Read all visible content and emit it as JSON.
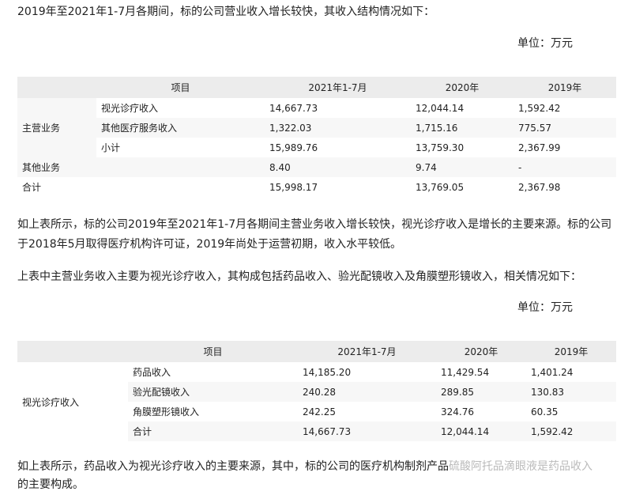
{
  "intro1": "2019年至2021年1-7月各期间，标的公司营业收入增长较快，其收入结构情况如下：",
  "unit1": "单位：万元",
  "table1": {
    "headers": [
      "项目",
      "2021年1-7月",
      "2020年",
      "2019年"
    ],
    "group_main": "主营业务",
    "rows": [
      {
        "item": "视光诊疗收入",
        "v2021": "14,667.73",
        "v2020": "12,044.14",
        "v2019": "1,592.42"
      },
      {
        "item": "其他医疗服务收入",
        "v2021": "1,322.03",
        "v2020": "1,715.16",
        "v2019": "775.57"
      },
      {
        "item": "小计",
        "v2021": "15,989.76",
        "v2020": "13,759.30",
        "v2019": "2,367.99"
      }
    ],
    "other": {
      "label": "其他业务",
      "v2021": "8.40",
      "v2020": "9.74",
      "v2019": "-"
    },
    "total": {
      "label": "合计",
      "v2021": "15,998.17",
      "v2020": "13,769.05",
      "v2019": "2,367.98"
    }
  },
  "para2_line1": "如上表所示，标的公司2019年至2021年1-7月各期间主营业务收入增长较快，视光诊疗收入是增长的主要来源。标的公司",
  "para2_line2": "于2018年5月取得医疗机构许可证，2019年尚处于运营初期，收入水平较低。",
  "para3": "上表中主营业务收入主要为视光诊疗收入，其构成包括药品收入、验光配镜收入及角膜塑形镜收入，相关情况如下：",
  "unit2": "单位：万元",
  "table2": {
    "headers": [
      "项目",
      "2021年1-7月",
      "2020年",
      "2019年"
    ],
    "group": "视光诊疗收入",
    "rows": [
      {
        "item": "药品收入",
        "v2021": "14,185.20",
        "v2020": "11,429.54",
        "v2019": "1,401.24"
      },
      {
        "item": "验光配镜收入",
        "v2021": "240.28",
        "v2020": "289.85",
        "v2019": "130.83"
      },
      {
        "item": "角膜塑形镜收入",
        "v2021": "242.25",
        "v2020": "324.76",
        "v2019": "60.35"
      },
      {
        "item": "合计",
        "v2021": "14,667.73",
        "v2020": "12,044.14",
        "v2019": "1,592.42"
      }
    ]
  },
  "para4_line1": "如上表所示，药品收入为视光诊疗收入的主要来源，其中，标的公司的医疗机构制剂产品",
  "para4_line1_tail": "硫酸阿托品滴眼液是药品收入",
  "para4_line2": "的主要构成。"
}
